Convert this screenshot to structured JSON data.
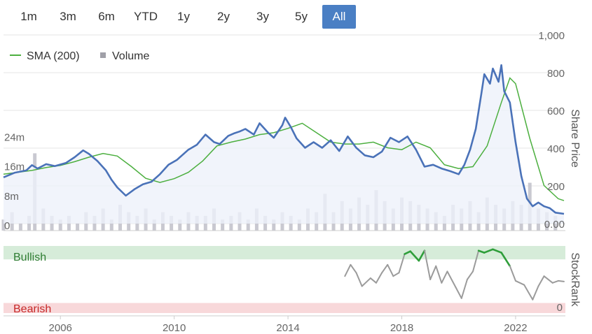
{
  "range_selector": {
    "buttons": [
      "1m",
      "3m",
      "6m",
      "YTD",
      "1y",
      "2y",
      "3y",
      "5y",
      "All"
    ],
    "active": "All"
  },
  "legend": {
    "sma_label": "SMA (200)",
    "volume_label": "Volume"
  },
  "colors": {
    "price": "#4a72b8",
    "sma": "#4caf3f",
    "volume": "#c9c9d1",
    "price_fill": "#eef1fa",
    "bullish_band": "#d6ecd9",
    "bearish_band": "#f8d8da",
    "rank_neutral": "#9b9b9b",
    "rank_bullish": "#2e9e3a",
    "rank_bearish": "#e0383e",
    "active_button": "#4a7fc4"
  },
  "chart_data": [
    {
      "type": "line",
      "title": "",
      "xlabel": "",
      "ylabel": "Share Price",
      "ylim": [
        0,
        1000
      ],
      "yticks": [
        "0.00",
        "200",
        "400",
        "600",
        "800",
        "1,000"
      ],
      "xticks": [
        "2006",
        "2010",
        "2014",
        "2018",
        "2022"
      ],
      "grid": true,
      "legend_position": "top-left",
      "series": [
        {
          "name": "",
          "role": "price",
          "x": [
            2004.0,
            2004.4,
            2004.8,
            2005.0,
            2005.2,
            2005.5,
            2005.8,
            2006.2,
            2006.5,
            2006.8,
            2007.0,
            2007.3,
            2007.6,
            2007.8,
            2008.0,
            2008.3,
            2008.6,
            2008.9,
            2009.2,
            2009.5,
            2009.8,
            2010.1,
            2010.5,
            2010.8,
            2011.1,
            2011.4,
            2011.6,
            2011.9,
            2012.1,
            2012.3,
            2012.5,
            2012.8,
            2013.0,
            2013.3,
            2013.5,
            2013.8,
            2013.9,
            2014.1,
            2014.3,
            2014.6,
            2014.9,
            2015.2,
            2015.5,
            2015.8,
            2016.1,
            2016.4,
            2016.7,
            2017.0,
            2017.3,
            2017.6,
            2017.9,
            2018.2,
            2018.5,
            2018.8,
            2019.1,
            2019.4,
            2019.7,
            2020.0,
            2020.2,
            2020.4,
            2020.6,
            2020.8,
            2020.9,
            2021.1,
            2021.2,
            2021.4,
            2021.5,
            2021.6,
            2021.8,
            2022.0,
            2022.2,
            2022.4,
            2022.6,
            2022.8,
            2023.0,
            2023.2,
            2023.4,
            2023.7
          ],
          "values": [
            245,
            270,
            282,
            310,
            292,
            315,
            305,
            322,
            352,
            388,
            370,
            332,
            282,
            232,
            192,
            148,
            182,
            208,
            222,
            262,
            312,
            338,
            392,
            418,
            472,
            432,
            422,
            465,
            478,
            488,
            502,
            472,
            532,
            482,
            455,
            522,
            562,
            512,
            452,
            402,
            432,
            402,
            442,
            385,
            462,
            402,
            362,
            352,
            382,
            455,
            432,
            462,
            392,
            302,
            312,
            292,
            278,
            262,
            312,
            392,
            502,
            692,
            792,
            742,
            822,
            752,
            840,
            702,
            642,
            432,
            252,
            132,
            92,
            112,
            92,
            82,
            58,
            52
          ]
        },
        {
          "name": "SMA (200)",
          "role": "sma",
          "x": [
            2004.0,
            2004.5,
            2005.0,
            2005.5,
            2006.0,
            2006.5,
            2007.0,
            2007.5,
            2008.0,
            2008.5,
            2009.0,
            2009.5,
            2010.0,
            2010.5,
            2011.0,
            2011.5,
            2012.0,
            2012.5,
            2013.0,
            2013.5,
            2014.0,
            2014.5,
            2015.0,
            2015.5,
            2016.0,
            2016.5,
            2017.0,
            2017.5,
            2018.0,
            2018.5,
            2019.0,
            2019.5,
            2020.0,
            2020.5,
            2021.0,
            2021.5,
            2021.8,
            2022.0,
            2022.5,
            2023.0,
            2023.5,
            2023.7
          ],
          "values": [
            262,
            272,
            282,
            297,
            308,
            328,
            352,
            372,
            358,
            302,
            240,
            218,
            238,
            272,
            332,
            412,
            432,
            448,
            472,
            482,
            505,
            532,
            482,
            432,
            422,
            422,
            432,
            402,
            392,
            432,
            402,
            312,
            292,
            302,
            412,
            642,
            772,
            742,
            452,
            202,
            132,
            122
          ]
        }
      ]
    },
    {
      "type": "bar",
      "title": "",
      "ylabel": "",
      "ylim": [
        0,
        30
      ],
      "yticks": [
        "0",
        "8m",
        "16m",
        "24m"
      ],
      "series": [
        {
          "name": "Volume",
          "role": "volume",
          "unit": "m",
          "x": [
            2004.0,
            2004.3,
            2004.6,
            2004.9,
            2005.1,
            2005.4,
            2005.7,
            2006.0,
            2006.3,
            2006.6,
            2006.9,
            2007.2,
            2007.5,
            2007.8,
            2008.1,
            2008.4,
            2008.7,
            2009.0,
            2009.3,
            2009.6,
            2009.9,
            2010.2,
            2010.5,
            2010.8,
            2011.1,
            2011.4,
            2011.7,
            2012.0,
            2012.3,
            2012.6,
            2012.9,
            2013.2,
            2013.5,
            2013.8,
            2014.1,
            2014.4,
            2014.7,
            2015.0,
            2015.3,
            2015.6,
            2015.9,
            2016.2,
            2016.5,
            2016.8,
            2017.1,
            2017.4,
            2017.7,
            2018.0,
            2018.3,
            2018.6,
            2018.9,
            2019.2,
            2019.5,
            2019.8,
            2020.1,
            2020.4,
            2020.7,
            2021.0,
            2021.3,
            2021.6,
            2021.9,
            2022.2,
            2022.5,
            2022.8,
            2023.1,
            2023.4
          ],
          "values": [
            3,
            5,
            2,
            4,
            21,
            6,
            4,
            3,
            4,
            2,
            5,
            4,
            6,
            3,
            7,
            5,
            4,
            6,
            3,
            5,
            4,
            3,
            5,
            4,
            4,
            6,
            3,
            4,
            5,
            3,
            6,
            4,
            3,
            5,
            4,
            3,
            6,
            5,
            10,
            5,
            8,
            6,
            9,
            7,
            11,
            8,
            6,
            9,
            8,
            7,
            6,
            5,
            4,
            7,
            6,
            8,
            5,
            9,
            7,
            6,
            8,
            7,
            13,
            6,
            5,
            4
          ]
        }
      ]
    },
    {
      "type": "line",
      "title": "",
      "ylabel": "StockRank",
      "ylim": [
        0,
        100
      ],
      "yticks": [
        "0"
      ],
      "bands": [
        {
          "label": "Bullish",
          "from": 80,
          "to": 100
        },
        {
          "label": "Bearish",
          "from": 0,
          "to": 15
        }
      ],
      "series": [
        {
          "name": "",
          "role": "stockrank",
          "x": [
            2016.0,
            2016.2,
            2016.4,
            2016.6,
            2016.9,
            2017.1,
            2017.3,
            2017.5,
            2017.7,
            2017.9,
            2018.1,
            2018.3,
            2018.6,
            2018.8,
            2019.0,
            2019.2,
            2019.4,
            2019.6,
            2019.9,
            2020.1,
            2020.3,
            2020.5,
            2020.7,
            2020.9,
            2021.2,
            2021.5,
            2021.8,
            2022.0,
            2022.3,
            2022.6,
            2022.8,
            2023.0,
            2023.3,
            2023.5,
            2023.7
          ],
          "values": [
            55,
            72,
            60,
            40,
            52,
            45,
            60,
            72,
            55,
            60,
            88,
            92,
            78,
            93,
            50,
            70,
            45,
            62,
            38,
            22,
            50,
            62,
            93,
            90,
            95,
            90,
            70,
            48,
            42,
            20,
            40,
            55,
            45,
            48,
            47
          ]
        }
      ]
    }
  ]
}
